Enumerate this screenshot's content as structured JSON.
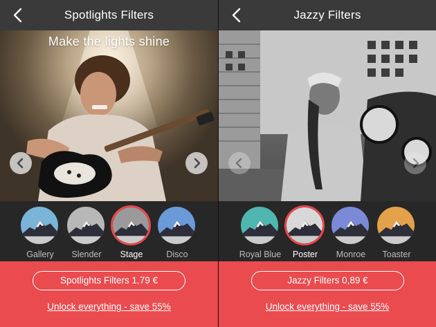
{
  "colors": {
    "accent": "#e94b4f",
    "navbar": "#3a3a3a",
    "strip": "#282828",
    "selected_ring": "#e8474b"
  },
  "left_panel": {
    "title": "Spotlights Filters",
    "back_icon": "chevron-left-icon",
    "caption": "Make the lights shine",
    "prev_icon": "chevron-left-icon",
    "next_icon": "chevron-right-icon",
    "filters": [
      {
        "label": "Gallery",
        "selected": false,
        "tint": "#7ab4d8"
      },
      {
        "label": "Slender",
        "selected": false,
        "tint": "#b8b8b8"
      },
      {
        "label": "Stage",
        "selected": true,
        "tint": "#9a9a9a"
      },
      {
        "label": "Disco",
        "selected": false,
        "tint": "#6a9ad8"
      }
    ],
    "buy_label": "Spotlights Filters 1,79 €",
    "unlock_label": "Unlock everything - save 55%"
  },
  "right_panel": {
    "title": "Jazzy Filters",
    "back_icon": "chevron-left-icon",
    "prev_icon": "chevron-left-icon",
    "next_icon": "chevron-right-icon",
    "filters": [
      {
        "label": "Royal Blue",
        "selected": false,
        "tint": "#4fb7b0"
      },
      {
        "label": "Poster",
        "selected": true,
        "tint": "#d8d8d8"
      },
      {
        "label": "Monroe",
        "selected": false,
        "tint": "#7a8ad6"
      },
      {
        "label": "Toaster",
        "selected": false,
        "tint": "#e3a24a"
      }
    ],
    "buy_label": "Jazzy Filters 0,89 €",
    "unlock_label": "Unlock everything - save 55%"
  }
}
